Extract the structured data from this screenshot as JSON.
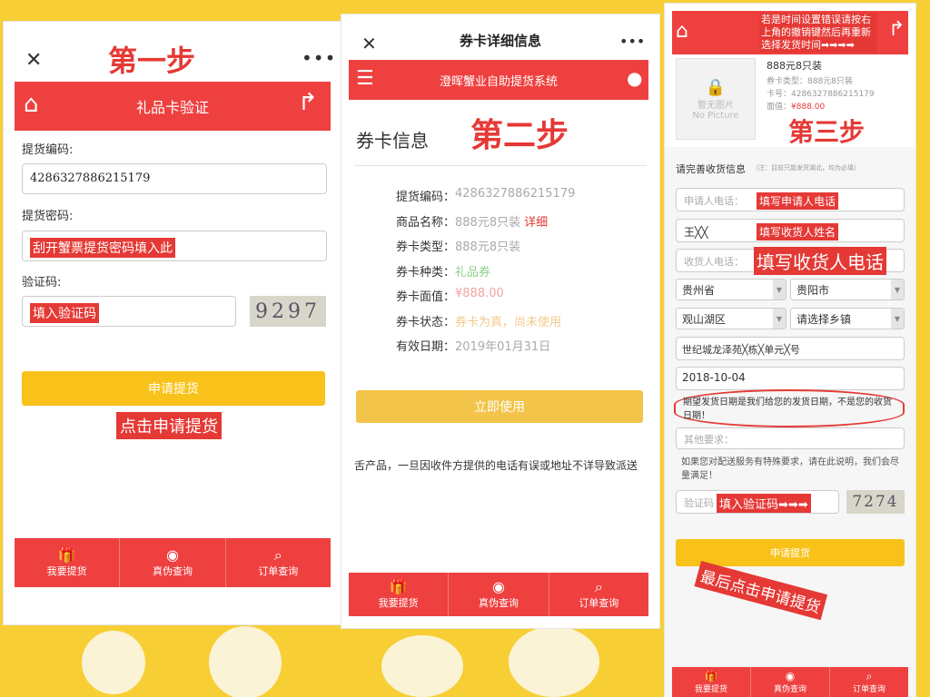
{
  "steps": {
    "one": "第一步",
    "two": "第二步",
    "three": "第三步"
  },
  "nav": {
    "buy": "我要提货",
    "verify": "真伪查询",
    "orders": "订单查询"
  },
  "screen1": {
    "header_title": "礼品卡验证",
    "code_label": "提货编码:",
    "code_value": "4286327886215179",
    "password_label": "提货密码:",
    "password_hint": "刮开蟹票提货密码填入此",
    "captcha_label": "验证码:",
    "captcha_hint": "填入验证码",
    "captcha_text": "9297",
    "submit": "申请提货",
    "click_hint": "点击申请提货"
  },
  "screen2": {
    "window_title": "券卡详细信息",
    "app_title": "澄晖蟹业自助提货系统",
    "section_title": "券卡信息",
    "rows": [
      {
        "k": "提货编码：",
        "v": "4286327886215179",
        "extra": ""
      },
      {
        "k": "商品名称：",
        "v": "888元8只装",
        "extra": "详细"
      },
      {
        "k": "券卡类型：",
        "v": "888元8只装",
        "extra": ""
      },
      {
        "k": "券卡种类：",
        "v": "礼品券",
        "extra": ""
      },
      {
        "k": "券卡面值：",
        "v": "¥888.00",
        "extra": ""
      },
      {
        "k": "券卡状态：",
        "v": "券卡为真，尚未使用",
        "extra": ""
      },
      {
        "k": "有效日期：",
        "v": "2019年01月31日",
        "extra": ""
      }
    ],
    "use_button": "立即使用",
    "notice": "舌产品，一旦因收件方提供的电话有误或地址不详导致派送"
  },
  "screen3": {
    "top_note": "若是时间设置错误请按右上角的撤销键然后再重新选择发货时间➡➡➡➡",
    "product_name": "888元8只装",
    "no_pic_line1": "暂无图片",
    "no_pic_line2": "No Picture",
    "card_type": "券卡类型：888元8只装",
    "card_no": "卡号：4286327886215179",
    "face_label": "面值：",
    "face_value": "¥888.00",
    "form_title": "请完善收货信息",
    "form_sub": "（注：目前只能发货湖北，均为必填）",
    "applicant_phone": "申请人电话：",
    "applicant_hint": "填写申请人电话",
    "receiver_name_value": "王╳╳",
    "receiver_name_hint": "填写收货人姓名",
    "receiver_phone": "收货人电话：",
    "receiver_phone_hint": "填写收货人电话",
    "province": "贵州省",
    "city": "贵阳市",
    "district": "观山湖区",
    "town": "请选择乡镇",
    "address": "世纪城龙泽苑╳栋╳单元╳号",
    "date": "2018-10-04",
    "date_note": "期望发货日期是我们给您的发货日期，不是您的收货日期！",
    "other_req": "其他要求：",
    "service_note": "如果您对配送服务有特殊要求，请在此说明，我们会尽量满足！",
    "captcha_label": "验证码",
    "captcha_hint": "填入验证码➡➡➡",
    "captcha_text": "7274",
    "submit": "申请提货",
    "final_hint": "最后点击申请提货"
  }
}
